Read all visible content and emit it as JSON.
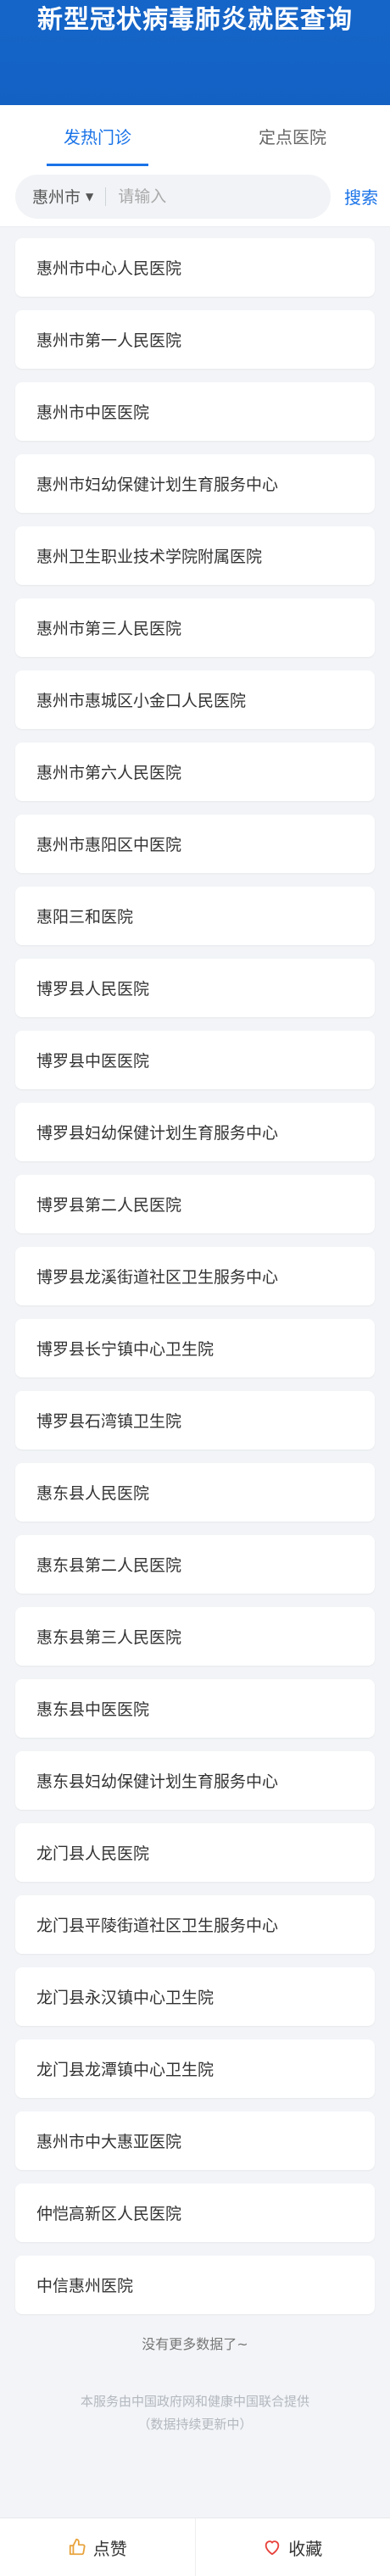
{
  "header": {
    "title": "新型冠状病毒肺炎就医查询"
  },
  "tabs": [
    {
      "label": "发热门诊",
      "active": true
    },
    {
      "label": "定点医院",
      "active": false
    }
  ],
  "search": {
    "city": "惠州市",
    "placeholder": "请输入",
    "button_label": "搜索"
  },
  "hospitals": [
    "惠州市中心人民医院",
    "惠州市第一人民医院",
    "惠州市中医医院",
    "惠州市妇幼保健计划生育服务中心",
    "惠州卫生职业技术学院附属医院",
    "惠州市第三人民医院",
    "惠州市惠城区小金口人民医院",
    "惠州市第六人民医院",
    "惠州市惠阳区中医院",
    "惠阳三和医院",
    "博罗县人民医院",
    "博罗县中医医院",
    "博罗县妇幼保健计划生育服务中心",
    "博罗县第二人民医院",
    "博罗县龙溪街道社区卫生服务中心",
    "博罗县长宁镇中心卫生院",
    "博罗县石湾镇卫生院",
    "惠东县人民医院",
    "惠东县第二人民医院",
    "惠东县第三人民医院",
    "惠东县中医医院",
    "惠东县妇幼保健计划生育服务中心",
    "龙门县人民医院",
    "龙门县平陵街道社区卫生服务中心",
    "龙门县永汉镇中心卫生院",
    "龙门县龙潭镇中心卫生院",
    "惠州市中大惠亚医院",
    "仲恺高新区人民医院",
    "中信惠州医院"
  ],
  "list_end_text": "没有更多数据了~",
  "footer": {
    "line1": "本服务由中国政府网和健康中国联合提供",
    "line2": "（数据持续更新中）"
  },
  "bottom_bar": {
    "like_label": "点赞",
    "like_icon": "thumbs-up-icon",
    "favorite_label": "收藏",
    "favorite_icon": "heart-icon"
  },
  "colors": {
    "brand_blue": "#1565c8",
    "accent": "#1a73e8",
    "like_icon": "#e8a33d",
    "favorite_icon": "#e8423c"
  }
}
